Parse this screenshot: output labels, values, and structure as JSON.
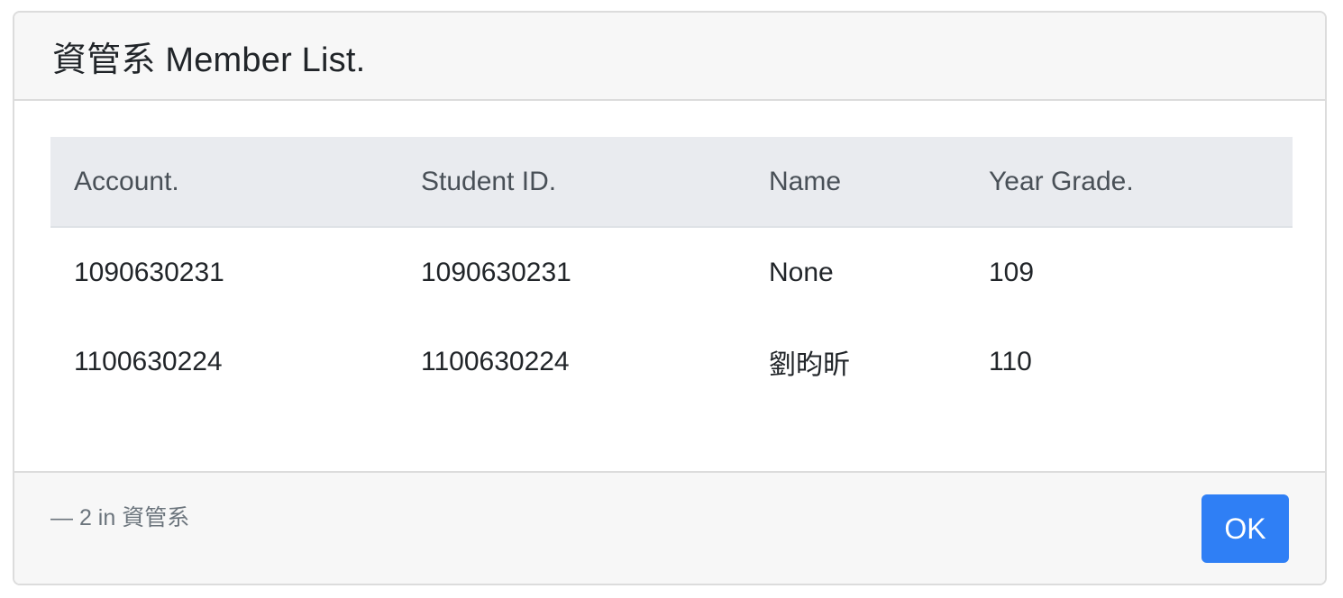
{
  "modal": {
    "title": "資管系 Member List.",
    "table": {
      "headers": [
        "Account.",
        "Student ID.",
        "Name",
        "Year Grade."
      ],
      "rows": [
        [
          "1090630231",
          "1090630231",
          "None",
          "109"
        ],
        [
          "1100630224",
          "1100630224",
          "劉昀昕",
          "110"
        ]
      ]
    },
    "footer": {
      "note": "— 2 in 資管系",
      "ok_label": "OK"
    }
  },
  "colors": {
    "primary_button": "#2f7ff5",
    "header_bg": "#f7f7f7",
    "table_head_bg": "#e9ebef"
  }
}
